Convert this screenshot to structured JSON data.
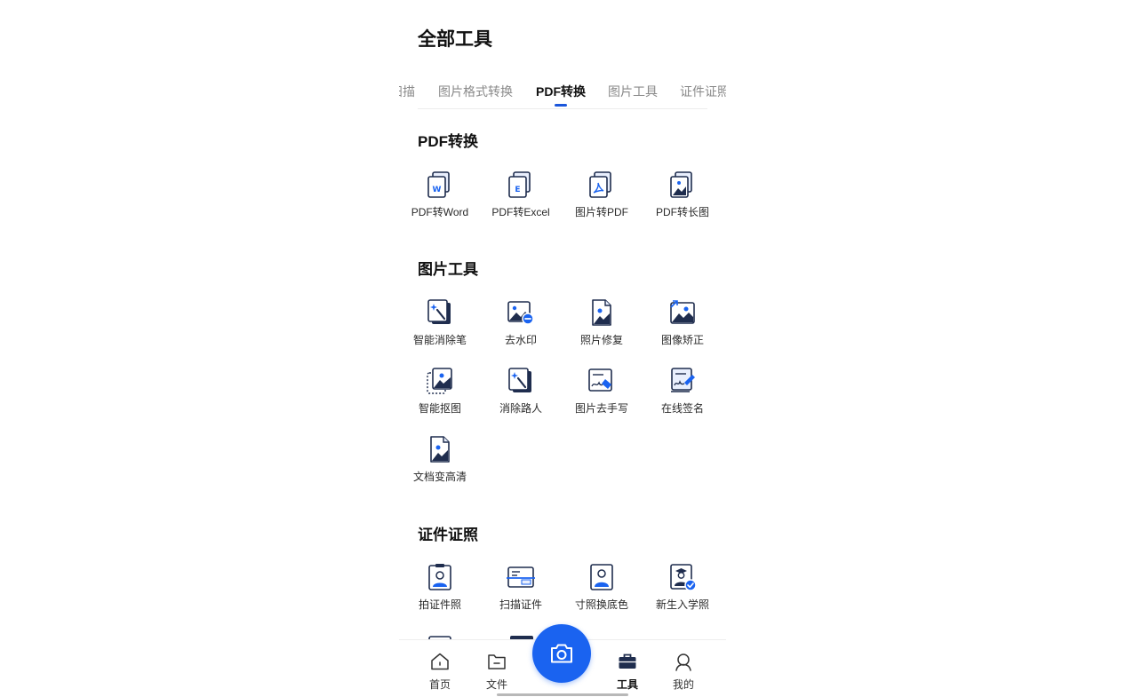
{
  "page": {
    "title": "全部工具"
  },
  "tabs": [
    {
      "label": "扫描"
    },
    {
      "label": "图片格式转换"
    },
    {
      "label": "PDF转换",
      "active": true
    },
    {
      "label": "图片工具"
    },
    {
      "label": "证件证照"
    }
  ],
  "sections": [
    {
      "title": "PDF转换",
      "tools": [
        {
          "label": "PDF转Word",
          "icon": "pdf-to-word-icon"
        },
        {
          "label": "PDF转Excel",
          "icon": "pdf-to-excel-icon"
        },
        {
          "label": "图片转PDF",
          "icon": "image-to-pdf-icon"
        },
        {
          "label": "PDF转长图",
          "icon": "pdf-to-long-image-icon"
        }
      ]
    },
    {
      "title": "图片工具",
      "tools": [
        {
          "label": "智能消除笔",
          "icon": "magic-eraser-icon"
        },
        {
          "label": "去水印",
          "icon": "remove-watermark-icon"
        },
        {
          "label": "照片修复",
          "icon": "photo-restore-icon"
        },
        {
          "label": "图像矫正",
          "icon": "image-correction-icon"
        },
        {
          "label": "智能抠图",
          "icon": "smart-cutout-icon"
        },
        {
          "label": "消除路人",
          "icon": "remove-passerby-icon"
        },
        {
          "label": "图片去手写",
          "icon": "remove-handwriting-icon"
        },
        {
          "label": "在线签名",
          "icon": "online-signature-icon"
        },
        {
          "label": "文档变高清",
          "icon": "document-hd-icon"
        }
      ]
    },
    {
      "title": "证件证照",
      "tools": [
        {
          "label": "拍证件照",
          "icon": "id-photo-icon"
        },
        {
          "label": "扫描证件",
          "icon": "scan-id-card-icon"
        },
        {
          "label": "寸照换底色",
          "icon": "photo-background-icon"
        },
        {
          "label": "新生入学照",
          "icon": "enrollment-photo-icon"
        }
      ]
    }
  ],
  "bottom_nav": [
    {
      "label": "首页",
      "icon": "home-icon"
    },
    {
      "label": "文件",
      "icon": "folder-icon"
    },
    {
      "label": "工具",
      "icon": "toolbox-icon",
      "active": true
    },
    {
      "label": "我的",
      "icon": "user-icon"
    }
  ],
  "camera_button": {
    "icon": "camera-icon"
  },
  "colors": {
    "accent": "#1a63f0",
    "icon_dark": "#1f2d4e",
    "icon_light": "#e9effd"
  }
}
